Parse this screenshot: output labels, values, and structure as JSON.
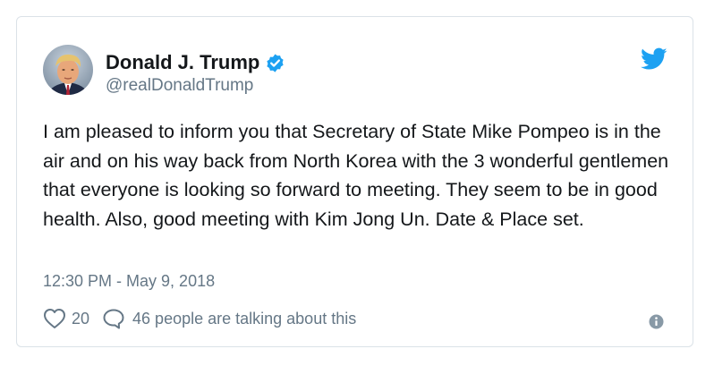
{
  "tweet": {
    "display_name": "Donald J. Trump",
    "handle": "@realDonaldTrump",
    "verified": true,
    "text": "I am pleased to inform you that Secretary of State Mike Pompeo is in the air and on his way back from North Korea with the 3 wonderful gentlemen that everyone is looking so forward to meeting. They seem to be in good health. Also, good meeting with Kim Jong Un. Date & Place set.",
    "timestamp": "12:30 PM - May 9, 2018",
    "like_count": "20",
    "talking_label": "46 people are talking about this"
  },
  "icons": {
    "verified": "verified-badge-icon",
    "brand": "twitter-bird-icon",
    "like": "heart-icon",
    "reply": "speech-bubble-icon",
    "info": "info-icon"
  },
  "colors": {
    "brand_blue": "#1da1f2",
    "text_primary": "#14171a",
    "text_secondary": "#657786",
    "border": "#dbe2e8"
  }
}
